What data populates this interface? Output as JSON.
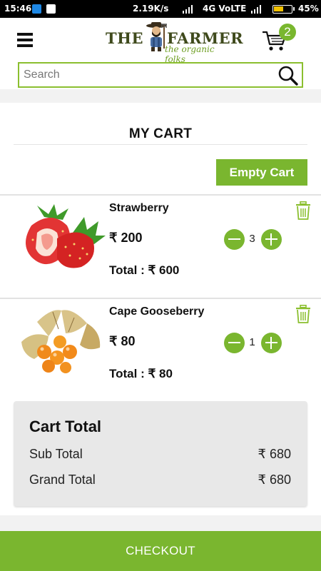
{
  "status_bar": {
    "time": "15:46",
    "net_speed": "2.19K/s",
    "network": "4G VoLTE",
    "battery": "45%"
  },
  "header": {
    "logo_word1": "THE",
    "logo_word2": "FARMER",
    "logo_tagline": "the organic folks",
    "cart_count": "2",
    "search_placeholder": "Search"
  },
  "cart": {
    "title": "MY CART",
    "empty_label": "Empty Cart",
    "items": [
      {
        "name": "Strawberry",
        "price": "₹ 200",
        "quantity": "3",
        "total": "Total : ₹ 600"
      },
      {
        "name": "Cape Gooseberry",
        "price": "₹ 80",
        "quantity": "1",
        "total": "Total : ₹ 80"
      }
    ]
  },
  "cart_total": {
    "heading": "Cart Total",
    "sub_total_label": "Sub Total",
    "sub_total_value": "₹ 680",
    "grand_total_label": "Grand Total",
    "grand_total_value": "₹ 680"
  },
  "checkout_label": "CHECKOUT",
  "colors": {
    "accent": "#7ab62f",
    "search_border": "#8bbf2f"
  }
}
